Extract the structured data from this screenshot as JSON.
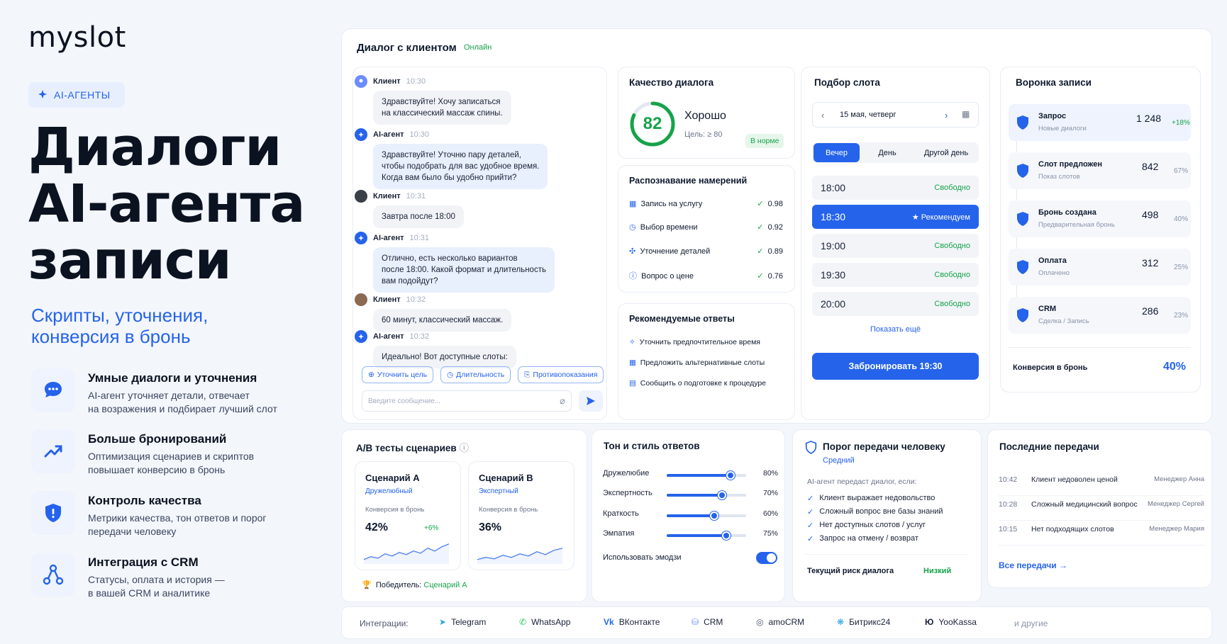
{
  "brand": {
    "logo": "myslot",
    "tag": "AI-АГЕНТЫ"
  },
  "hero": {
    "line1": "Диалоги",
    "line2": "AI-агента",
    "line3": "записи",
    "sub1": "Скрипты, уточнения,",
    "sub2": "конверсия в бронь"
  },
  "features": [
    {
      "title": "Умные диалоги и уточнения",
      "l1": "AI-агент уточняет детали, отвечает",
      "l2": "на возражения и подбирает лучший слот",
      "icon": "chat-bubble-icon"
    },
    {
      "title": "Больше бронирований",
      "l1": "Оптимизация сценариев и скриптов",
      "l2": "повышает конверсию в бронь",
      "icon": "trend-up-icon"
    },
    {
      "title": "Контроль качества",
      "l1": "Метрики качества, тон ответов и порог",
      "l2": "передачи человеку",
      "icon": "shield-icon"
    },
    {
      "title": "Интеграция с CRM",
      "l1": "Статусы, оплата и история —",
      "l2": "в вашей CRM и аналитике",
      "icon": "network-icon"
    }
  ],
  "dialog": {
    "title": "Диалог с клиентом",
    "status": "Онлайн",
    "messages": [
      {
        "who": "Клиент",
        "time": "10:30",
        "l1": "Здравствуйте! Хочу записаться",
        "l2": "на классический массаж спины.",
        "l3": ""
      },
      {
        "who": "AI-агент",
        "time": "10:30",
        "l1": "Здравствуйте! Уточню пару деталей,",
        "l2": "чтобы подобрать для вас удобное время.",
        "l3": "Когда вам было бы удобно прийти?"
      },
      {
        "who": "Клиент",
        "time": "10:31",
        "l1": "Завтра после 18:00",
        "l2": "",
        "l3": ""
      },
      {
        "who": "AI-агент",
        "time": "10:31",
        "l1": "Отлично, есть несколько вариантов",
        "l2": "после 18:00. Какой формат и длительность",
        "l3": "вам подойдут?"
      },
      {
        "who": "Клиент",
        "time": "10:32",
        "l1": "60 минут, классический массаж.",
        "l2": "",
        "l3": ""
      },
      {
        "who": "AI-агент",
        "time": "10:32",
        "l1": "Идеально! Вот доступные слоты:",
        "l2": "",
        "l3": ""
      }
    ],
    "chips": [
      "Уточнить цель",
      "Длительность",
      "Противопоказания"
    ],
    "input_placeholder": "Введите сообщение..."
  },
  "quality": {
    "title": "Качество диалога",
    "score": "82",
    "score_value": 82,
    "label": "Хорошо",
    "goal": "Цель: ≥ 80",
    "badge": "В норме"
  },
  "intents": {
    "title": "Распознавание намерений",
    "items": [
      {
        "name": "Запись на услугу",
        "score": "0.98"
      },
      {
        "name": "Выбор времени",
        "score": "0.92"
      },
      {
        "name": "Уточнение деталей",
        "score": "0.89"
      },
      {
        "name": "Вопрос о цене",
        "score": "0.76"
      }
    ]
  },
  "recommended": {
    "title": "Рекомендуемые ответы",
    "items": [
      "Уточнить предпочтительное время",
      "Предложить альтернативные слоты",
      "Сообщить о подготовке к процедуре"
    ]
  },
  "slots": {
    "title": "Подбор слота",
    "date": "15 мая, четверг",
    "tabs": [
      "Вечер",
      "День",
      "Другой день"
    ],
    "items": [
      {
        "time": "18:00",
        "status": "Свободно"
      },
      {
        "time": "18:30",
        "status": "★ Рекомендуем"
      },
      {
        "time": "19:00",
        "status": "Свободно"
      },
      {
        "time": "19:30",
        "status": "Свободно"
      },
      {
        "time": "20:00",
        "status": "Свободно"
      }
    ],
    "more": "Показать ещё",
    "book": "Забронировать 19:30"
  },
  "funnel": {
    "title": "Воронка записи",
    "items": [
      {
        "name": "Запрос",
        "sub": "Новые диалоги",
        "value": "1 248",
        "pct": "+18%"
      },
      {
        "name": "Слот предложен",
        "sub": "Показ слотов",
        "value": "842",
        "pct": "67%"
      },
      {
        "name": "Бронь создана",
        "sub": "Предварительная бронь",
        "value": "498",
        "pct": "40%"
      },
      {
        "name": "Оплата",
        "sub": "Оплачено",
        "value": "312",
        "pct": "25%"
      },
      {
        "name": "CRM",
        "sub": "Сделка / Запись",
        "value": "286",
        "pct": "23%"
      }
    ],
    "conv_label": "Конверсия в бронь",
    "conv_value": "40%"
  },
  "ab": {
    "title": "A/B тесты сценариев",
    "a": {
      "name": "Сценарий A",
      "style": "Дружелюбный",
      "conv_label": "Конверсия в бронь",
      "value": "42%",
      "delta": "+6%"
    },
    "b": {
      "name": "Сценарий B",
      "style": "Экспертный",
      "conv_label": "Конверсия в бронь",
      "value": "36%"
    },
    "winner_label": "Победитель:",
    "winner": "Сценарий A"
  },
  "tone": {
    "title": "Тон и стиль ответов",
    "items": [
      {
        "name": "Дружелюбие",
        "pct": "80%",
        "value": 80
      },
      {
        "name": "Экспертность",
        "pct": "70%",
        "value": 70
      },
      {
        "name": "Краткость",
        "pct": "60%",
        "value": 60
      },
      {
        "name": "Эмпатия",
        "pct": "75%",
        "value": 75
      }
    ],
    "emoji": "Использовать эмодзи"
  },
  "handoff": {
    "title": "Порог передачи человеку",
    "level": "Средний",
    "intro": "AI-агент передаст диалог, если:",
    "items": [
      "Клиент выражает недовольство",
      "Сложный вопрос вне базы знаний",
      "Нет доступных слотов / услуг",
      "Запрос на отмену / возврат"
    ],
    "risk_label": "Текущий риск диалога",
    "risk": "Низкий"
  },
  "transfers": {
    "title": "Последние передачи",
    "items": [
      {
        "time": "10:42",
        "reason": "Клиент недоволен ценой",
        "who": "Менеджер Анна"
      },
      {
        "time": "10:28",
        "reason": "Сложный медицинский вопрос",
        "who": "Менеджер Сергей"
      },
      {
        "time": "10:15",
        "reason": "Нет подходящих слотов",
        "who": "Менеджер Мария"
      }
    ],
    "all": "Все передачи →"
  },
  "integrations": {
    "label": "Интеграции:",
    "items": [
      "Telegram",
      "WhatsApp",
      "ВКонтакте",
      "CRM",
      "amoCRM",
      "Битрикс24",
      "YooKassa"
    ],
    "more": "и другие"
  },
  "colors": {
    "accent": "#2563eb",
    "green": "#16a34a",
    "text": "#0f1a2e"
  }
}
